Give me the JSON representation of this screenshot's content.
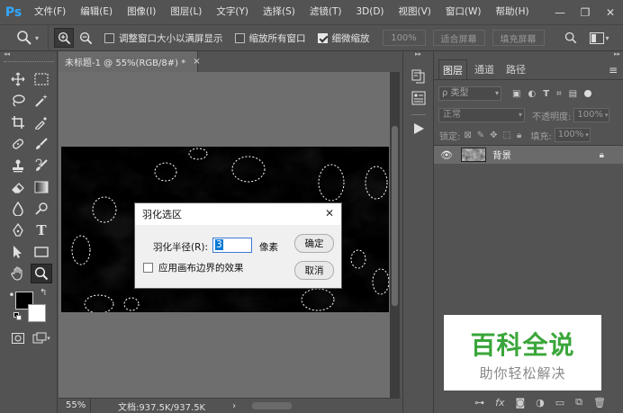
{
  "menubar": {
    "logo": "Ps",
    "items": [
      "文件(F)",
      "编辑(E)",
      "图像(I)",
      "图层(L)",
      "文字(Y)",
      "选择(S)",
      "滤镜(T)",
      "3D(D)",
      "视图(V)",
      "窗口(W)",
      "帮助(H)"
    ],
    "minimize": "—",
    "maximize": "❐",
    "close": "✕"
  },
  "options": {
    "resize_windows": "调整窗口大小以满屏显示",
    "zoom_all": "缩放所有窗口",
    "scrubby_zoom": "细微缩放",
    "zoom_value": "100%",
    "fit_screen": "适合屏幕",
    "fill_screen": "填充屏幕"
  },
  "document": {
    "tab_title": "未标题-1 @ 55%(RGB/8#) *",
    "tab_close": "×",
    "zoom": "55%",
    "doc_info": "文档:937.5K/937.5K",
    "status_arrow": "›"
  },
  "dialog": {
    "title": "羽化选区",
    "close": "✕",
    "radius_label": "羽化半径(R):",
    "radius_value": "3",
    "unit": "像素",
    "ok": "确定",
    "cancel": "取消",
    "canvas_bounds": "应用画布边界的效果"
  },
  "layers_panel": {
    "tabs": [
      "图层",
      "通道",
      "路径"
    ],
    "filter_kind": "ρ 类型",
    "blend_mode": "正常",
    "opacity_label": "不透明度:",
    "opacity_value": "100%",
    "lock_label": "锁定:",
    "fill_label": "填充:",
    "fill_value": "100%",
    "layer_name": "背景",
    "footer_fx": "fx"
  },
  "watermark": {
    "title": "百科全说",
    "subtitle": "助你轻松解决"
  },
  "colors": {
    "ui_bg": "#535353",
    "canvas_bg": "#6e6e6e",
    "ps_blue": "#31a8ff",
    "watermark_green": "#3aa63a"
  }
}
